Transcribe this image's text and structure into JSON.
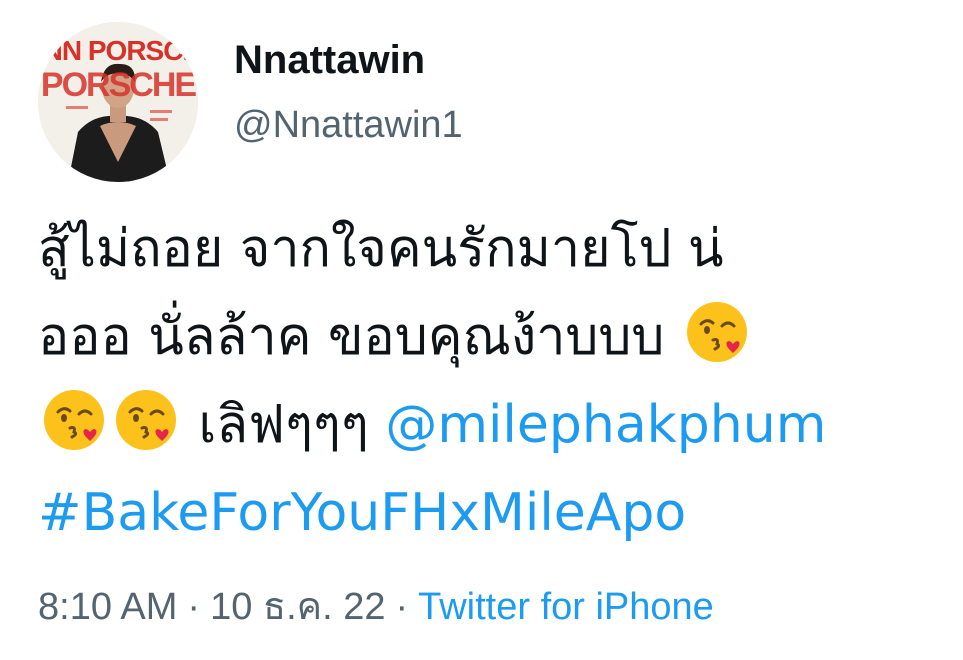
{
  "author": {
    "display_name": "Nnattawin",
    "handle": "@Nnattawin1",
    "avatar_text": "KINN PORSCHE"
  },
  "tweet": {
    "line1": "สู้ไม่ถอย จากใจคนรักมายโป น่",
    "line2": "อออ นั่ลล้าค ขอบคุณง้าบบบ",
    "line3_text": "เลิฟๆๆๆ",
    "mention": "@milephakphum",
    "hashtag": "#BakeForYouFHxMileApo",
    "emoji_icon": "face-blowing-kiss-icon"
  },
  "meta": {
    "time": "8:10 AM",
    "separator": "·",
    "date": "10 ธ.ค. 22",
    "source": "Twitter for iPhone"
  },
  "colors": {
    "text": "#0f1419",
    "secondary": "#536471",
    "link": "#1d9bf0",
    "avatar_brand": "#d6322a"
  }
}
